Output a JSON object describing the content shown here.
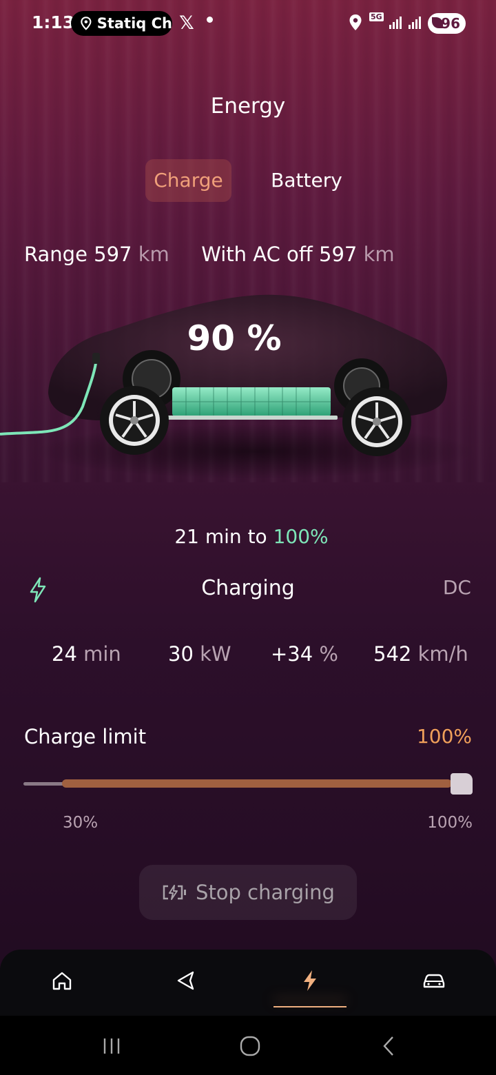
{
  "status_bar": {
    "time": "1:13",
    "pill_text": "Statiq Ch",
    "network": "5G",
    "battery": "96"
  },
  "header": {
    "title": "Energy"
  },
  "tabs": [
    {
      "label": "Charge",
      "active": true
    },
    {
      "label": "Battery",
      "active": false
    }
  ],
  "range": {
    "label": "Range",
    "value": "597",
    "unit": "km",
    "ac_off_label": "With AC off",
    "ac_off_value": "597",
    "ac_off_unit": "km"
  },
  "charge_level": {
    "value": 90,
    "text": "90 %"
  },
  "eta": {
    "prefix": "21 min to",
    "target": "100%"
  },
  "charging": {
    "status": "Charging",
    "type": "DC"
  },
  "stats": [
    {
      "value": "24",
      "unit": "min"
    },
    {
      "value": "30",
      "unit": "kW"
    },
    {
      "value": "+34",
      "unit": "%"
    },
    {
      "value": "542",
      "unit": "km/h"
    }
  ],
  "charge_limit": {
    "label": "Charge limit",
    "value": "100%",
    "min_label": "30%",
    "max_label": "100%",
    "level": 100
  },
  "stop_button": {
    "label": "Stop charging"
  },
  "bottom_nav": {
    "items": [
      "home-icon",
      "navigate-icon",
      "charge-icon",
      "car-icon"
    ],
    "active": "charge-icon"
  },
  "colors": {
    "accent_orange": "#f0a07a",
    "accent_green": "#7ee6b8",
    "limit_orange": "#f0a05a"
  }
}
